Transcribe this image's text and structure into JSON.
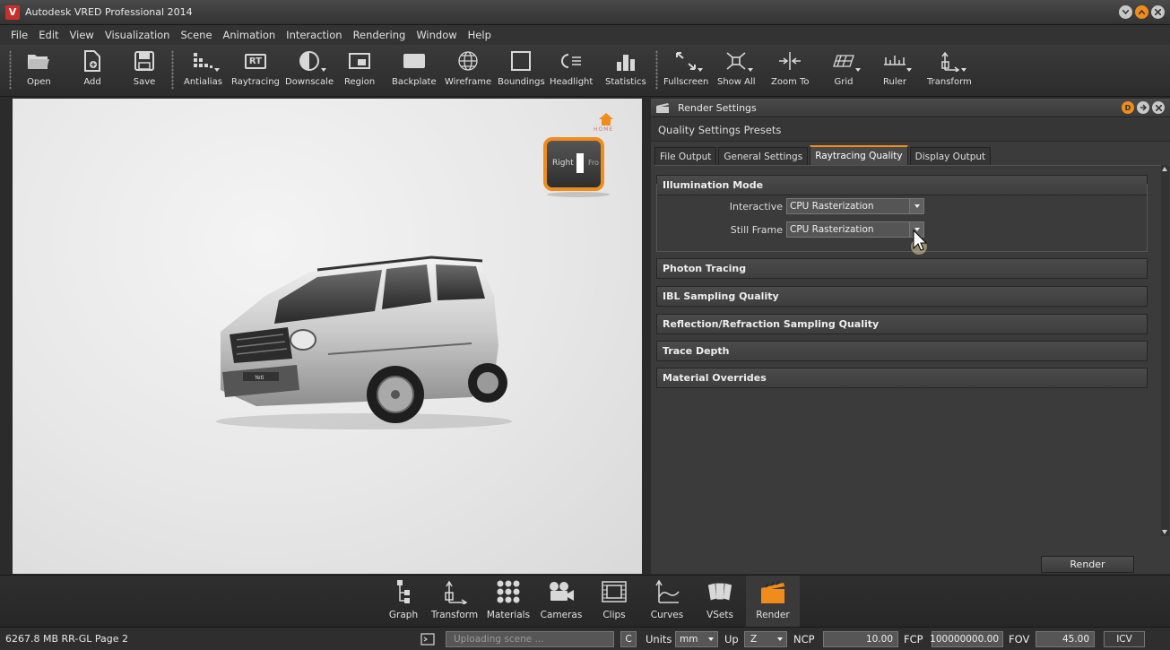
{
  "window": {
    "title": "Autodesk VRED Professional 2014",
    "logo_letter": "V",
    "colors": {
      "accent": "#f08c1c",
      "button_gray": "#c8c8c8"
    }
  },
  "menu": [
    "File",
    "Edit",
    "View",
    "Visualization",
    "Scene",
    "Animation",
    "Interaction",
    "Rendering",
    "Window",
    "Help"
  ],
  "toolbar": {
    "open": "Open",
    "add": "Add",
    "save": "Save",
    "antialias": "Antialias",
    "raytracing": "Raytracing",
    "raytracing_icon_text": "RT",
    "downscale": "Downscale",
    "region": "Region",
    "backplate": "Backplate",
    "wireframe": "Wireframe",
    "boundings": "Boundings",
    "headlight": "Headlight",
    "statistics": "Statistics",
    "fullscreen": "Fullscreen",
    "show_all": "Show All",
    "zoom_to": "Zoom To",
    "grid": "Grid",
    "ruler": "Ruler",
    "transform": "Transform"
  },
  "viewport": {
    "navcube_right": "Right",
    "navcube_front": "Fro",
    "home_label": "HOME",
    "plate_text": "Yeti"
  },
  "panel": {
    "title": "Render Settings",
    "header_badge": "D",
    "presets": "Quality Settings Presets",
    "tabs": [
      {
        "label": "File Output",
        "active": false
      },
      {
        "label": "General Settings",
        "active": false
      },
      {
        "label": "Raytracing Quality",
        "active": true
      },
      {
        "label": "Display Output",
        "active": false
      }
    ],
    "illumination": {
      "title": "Illumination Mode",
      "interactive_label": "Interactive",
      "interactive_value": "CPU Rasterization",
      "still_label": "Still Frame",
      "still_value": "CPU Rasterization"
    },
    "sections": [
      "Photon Tracing",
      "IBL Sampling Quality",
      "Reflection/Refraction Sampling Quality",
      "Trace Depth",
      "Material Overrides"
    ],
    "render_button": "Render"
  },
  "modules": [
    "Graph",
    "Transform",
    "Materials",
    "Cameras",
    "Clips",
    "Curves",
    "VSets",
    "Render"
  ],
  "status": {
    "left": "6267.8 MB  RR-GL  Page 2",
    "uploading": "Uploading scene ...",
    "c_button": "C",
    "units_label": "Units",
    "units_value": "mm",
    "up_label": "Up",
    "up_value": "Z",
    "ncp_label": "NCP",
    "ncp_value": "10.00",
    "fcp_label": "FCP",
    "fcp_value": "100000000.00",
    "fov_label": "FOV",
    "fov_value": "45.00",
    "icv": "ICV"
  }
}
